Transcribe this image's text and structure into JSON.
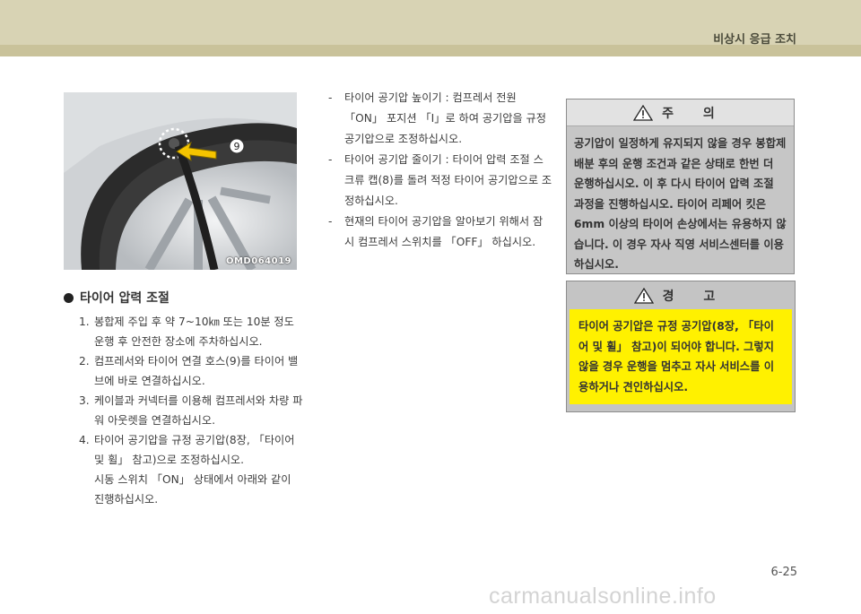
{
  "header": {
    "title": "비상시 응급 조치"
  },
  "figure": {
    "code": "OMD064019",
    "callout": "9"
  },
  "section": {
    "title": "타이어 압력 조절",
    "steps": [
      {
        "num": "1.",
        "text": "봉합제 주입 후 약 7~10㎞ 또는 10분 정도 운행 후 안전한 장소에 주차하십시오."
      },
      {
        "num": "2.",
        "text": "컴프레서와 타이어 연결 호스(9)를 타이어 밸브에 바로 연결하십시오."
      },
      {
        "num": "3.",
        "text": "케이블과 커넥터를 이용해 컴프레서와 차량 파워 아웃렛을 연결하십시오."
      },
      {
        "num": "4.",
        "text": "타이어 공기압을 규정 공기압(8장, 「타이어 및 휠」 참고)으로 조정하십시오."
      }
    ],
    "note": "시동 스위치 「ON」 상태에서 아래와 같이 진행하십시오."
  },
  "dash_items": [
    "타이어 공기압 높이기 : 컴프레서 전원 「ON」 포지션 「I」로 하여 공기압을 규정 공기압으로 조정하십시오.",
    "타이어 공기압 줄이기 : 타이어 압력 조절 스크류 캡(8)를 돌려 적정 타이어 공기압으로 조정하십시오.",
    "현재의 타이어 공기압을 알아보기 위해서 잠시 컴프레서 스위치를 「OFF」 하십시오."
  ],
  "caution": {
    "title": "주 의",
    "text": "공기압이 일정하게 유지되지 않을 경우 봉합제 배분 후의 운행 조건과 같은 상태로 한번 더 운행하십시오. 이 후 다시 타이어 압력 조절 과정을 진행하십시오. 타이어 리페어 킷은 6mm 이상의 타이어 손상에서는 유용하지 않습니다. 이 경우 자사 직영 서비스센터를 이용하십시오."
  },
  "warning": {
    "title": "경 고",
    "text": "타이어 공기압은 규정 공기압(8장, 「타이어 및 휠」 참고)이 되어야 합니다. 그렇지 않을 경우 운행을 멈추고 자사 서비스를 이용하거나 견인하십시오."
  },
  "footer": {
    "page_number": "6-25",
    "watermark": "carmanualsonline.info"
  },
  "colors": {
    "header": "#d8d3b4",
    "warning_body": "#fff100",
    "caution_body": "#c6c6c6"
  },
  "icons": {
    "caution": "warning-triangle-icon",
    "warning": "warning-triangle-icon",
    "bullet": "filled-circle-bullet"
  }
}
